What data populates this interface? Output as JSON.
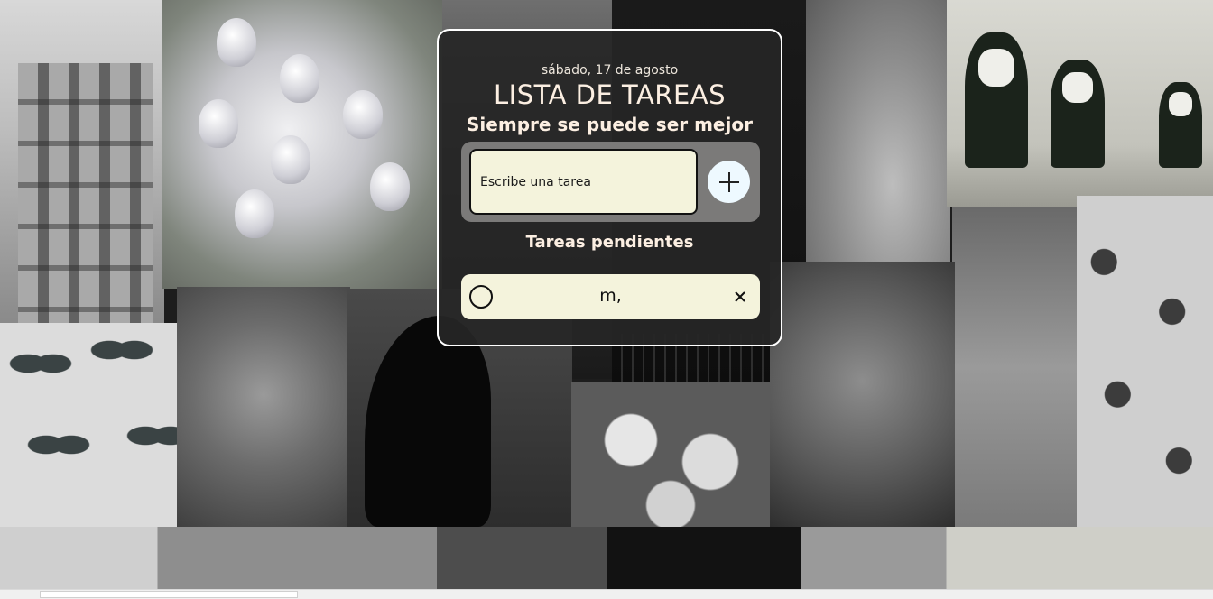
{
  "app": {
    "date": "sábado, 17 de agosto",
    "title": "LISTA DE TAREAS",
    "subtitle": "Siempre se puede ser mejor"
  },
  "input": {
    "placeholder": "Escribe una tarea",
    "value": "",
    "add_icon": "plus-icon"
  },
  "pending": {
    "title": "Tareas pendientes",
    "tasks": [
      {
        "text": "m,",
        "done": false,
        "check_icon": "circle-icon",
        "delete_icon": "close-icon"
      }
    ]
  },
  "colors": {
    "card_background": "#262626",
    "card_border": "#ffffff",
    "accent_cream": "#f4f3dc",
    "input_frame": "#7b7a79",
    "add_button": "#eef9ff",
    "heading_text": "#fcefe2"
  }
}
